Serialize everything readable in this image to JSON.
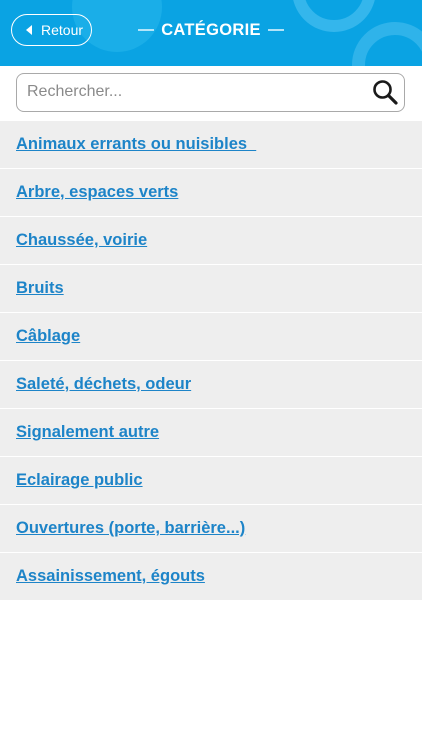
{
  "header": {
    "title": "CATÉGORIE",
    "back_label": "Retour",
    "background_color": "#0aa3e3"
  },
  "search": {
    "placeholder": "Rechercher...",
    "value": "",
    "icon": "search-icon"
  },
  "categories": [
    {
      "label": "Animaux errants ou nuisibles  "
    },
    {
      "label": "Arbre, espaces verts"
    },
    {
      "label": "Chaussée, voirie"
    },
    {
      "label": "Bruits"
    },
    {
      "label": "Câblage"
    },
    {
      "label": "Saleté, déchets, odeur"
    },
    {
      "label": "Signalement autre"
    },
    {
      "label": "Eclairage public"
    },
    {
      "label": "Ouvertures (porte, barrière...)"
    },
    {
      "label": "Assainissement, égouts"
    }
  ],
  "colors": {
    "link": "#1d84c8",
    "row_background": "#eeeeee"
  }
}
